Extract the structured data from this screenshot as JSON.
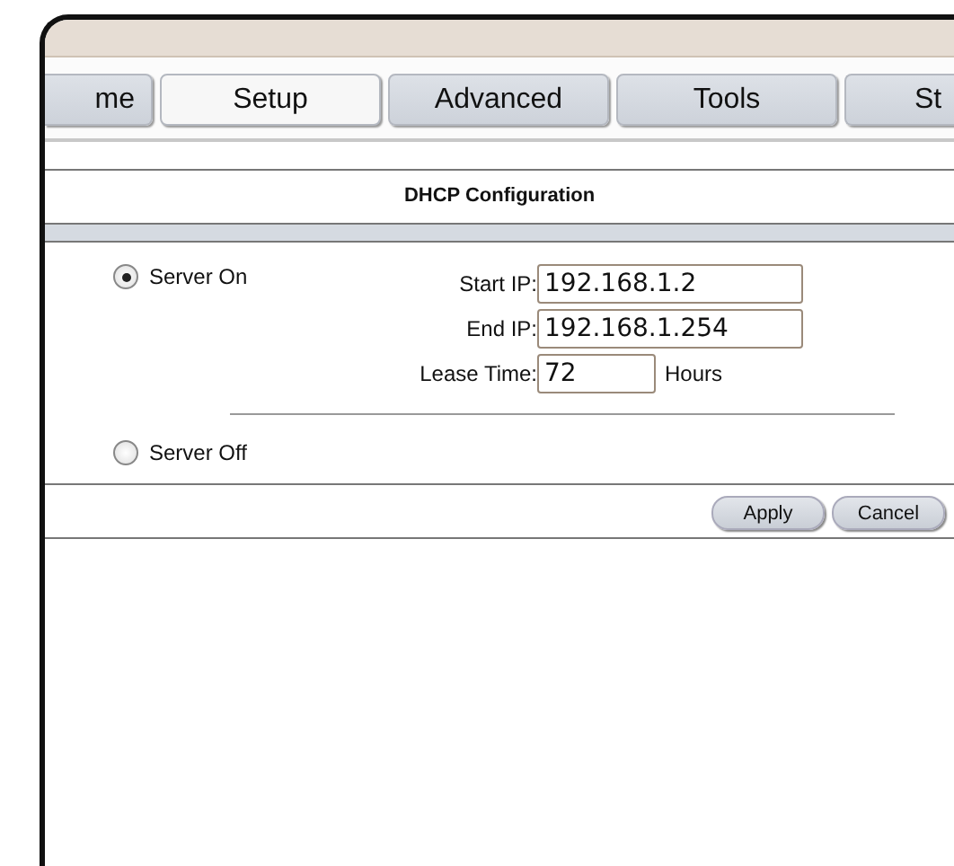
{
  "tabs": [
    {
      "label": "me",
      "selected": false
    },
    {
      "label": "Setup",
      "selected": true
    },
    {
      "label": "Advanced",
      "selected": false
    },
    {
      "label": "Tools",
      "selected": false
    },
    {
      "label": "St",
      "selected": false
    }
  ],
  "section": {
    "title": "DHCP Configuration"
  },
  "options": [
    {
      "label": "Server On",
      "selected": true
    },
    {
      "label": "Server Off",
      "selected": false
    }
  ],
  "fields": [
    {
      "label": "Start IP:",
      "value": "192.168.1.2"
    },
    {
      "label": "End IP:",
      "value": "192.168.1.254"
    },
    {
      "label": "Lease Time:",
      "value": "72",
      "unit": "Hours"
    }
  ],
  "buttons": [
    "Apply",
    "Cancel"
  ]
}
